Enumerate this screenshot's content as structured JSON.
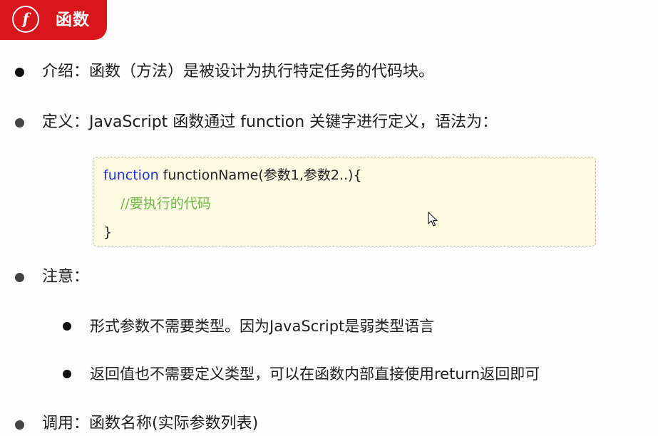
{
  "header": {
    "icon_glyph": "f",
    "title": "函数",
    "color": "#d9161b"
  },
  "bullets": {
    "intro": "介绍：函数（方法）是被设计为执行特定任务的代码块。",
    "definition": "定义：JavaScript 函数通过 function 关键字进行定义，语法为：",
    "note": "注意：",
    "call": "调用：函数名称(实际参数列表)"
  },
  "code": {
    "keyword": "function",
    "signature": " functionName(参数1,参数2..){",
    "comment": "//要执行的代码",
    "closing": "}",
    "keyword_color": "#1d2fd6",
    "comment_color": "#6fb449",
    "background": "#fdfbe1"
  },
  "sub_bullets": {
    "params": "形式参数不需要类型。因为JavaScript是弱类型语言",
    "return": "返回值也不需要定义类型，可以在函数内部直接使用return返回即可"
  },
  "cursor": {
    "icon": "mouse-pointer-icon"
  }
}
